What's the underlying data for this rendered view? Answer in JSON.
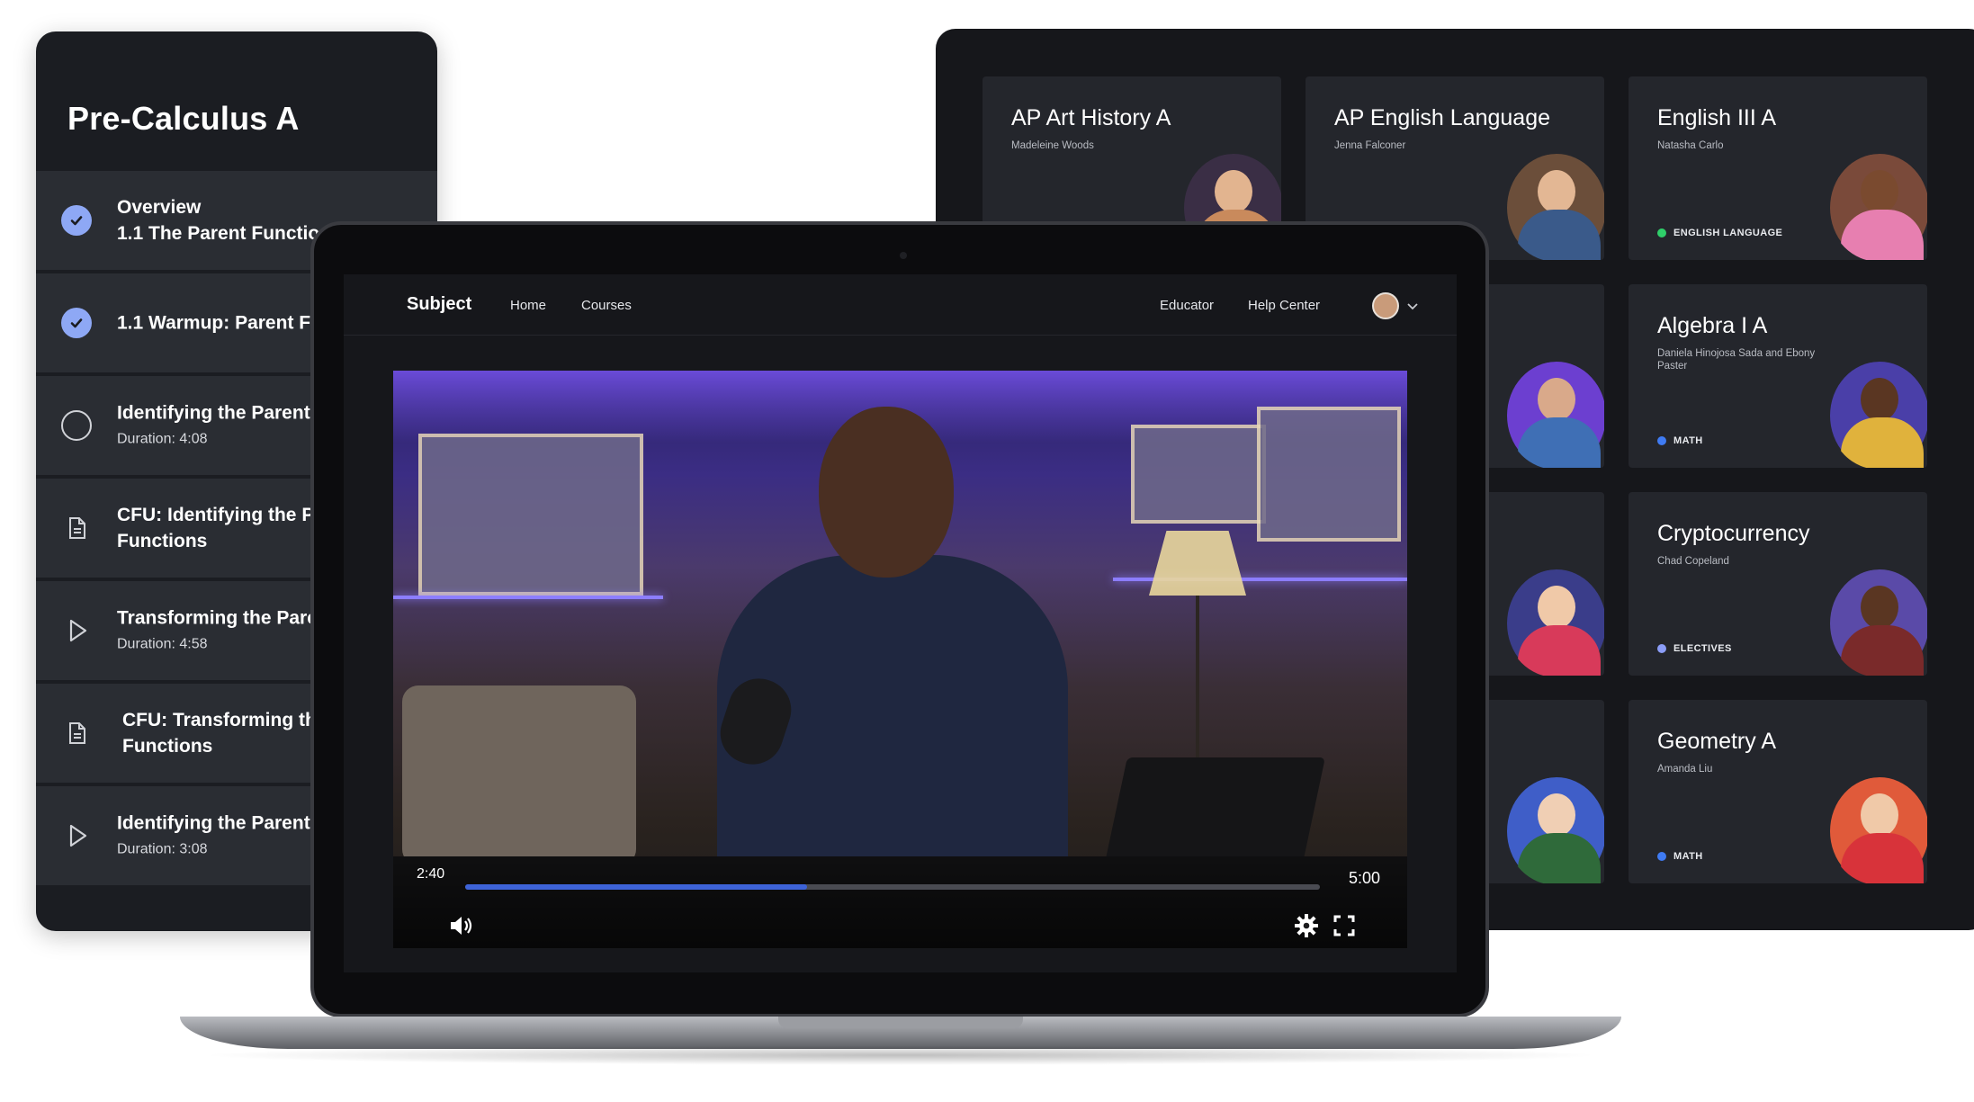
{
  "left_panel": {
    "course_title": "Pre-Calculus A",
    "lessons": [
      {
        "line1": "Overview",
        "line2": "1.1 The Parent Function",
        "duration": "",
        "status": "check-icon"
      },
      {
        "line1": "1.1 Warmup: Parent Fu",
        "line2": "",
        "duration": "",
        "status": "check-icon"
      },
      {
        "line1": "Identifying the Parent F",
        "line2": "",
        "duration": "Duration: 4:08",
        "status": "circle-icon"
      },
      {
        "line1": "CFU: Identifying the Pa",
        "line2": "Functions",
        "duration": "",
        "status": "document-icon"
      },
      {
        "line1": "Transforming the Paren",
        "line2": "",
        "duration": "Duration: 4:58",
        "status": "play-icon"
      },
      {
        "line1": "CFU: Transforming the",
        "line2": "Functions",
        "duration": "",
        "status": "document-icon"
      },
      {
        "line1": "Identifying the Parent F",
        "line2": "",
        "duration": "Duration: 3:08",
        "status": "play-icon"
      }
    ]
  },
  "course_grid": {
    "cards": [
      {
        "name": "AP Art History A",
        "teacher": "Madeleine Woods",
        "tag": "",
        "tag_color": ""
      },
      {
        "name": "AP English Language",
        "teacher": "Jenna Falconer",
        "tag": "",
        "tag_color": ""
      },
      {
        "name": "English III A",
        "teacher": "Natasha Carlo",
        "tag": "ENGLISH LANGUAGE",
        "tag_color": "#2fcf6a"
      },
      {
        "name": "Algebra I A",
        "teacher": "Daniela Hinojosa Sada and Ebony Paster",
        "tag": "MATH",
        "tag_color": "#3f7bf3"
      },
      {
        "name": "Cryptocurrency",
        "teacher": "Chad Copeland",
        "tag": "ELECTIVES",
        "tag_color": "#8b9df8"
      },
      {
        "name": "Geometry A",
        "teacher": "Amanda Liu",
        "tag": "MATH",
        "tag_color": "#3f7bf3"
      }
    ]
  },
  "app": {
    "brand": "Subject",
    "nav_links": [
      "Home",
      "Courses"
    ],
    "nav_right_links": [
      "Educator",
      "Help Center"
    ]
  },
  "player": {
    "current_time": "2:40",
    "total_time": "5:00",
    "progress": 0.4,
    "accent_color": "#3d63d8"
  }
}
